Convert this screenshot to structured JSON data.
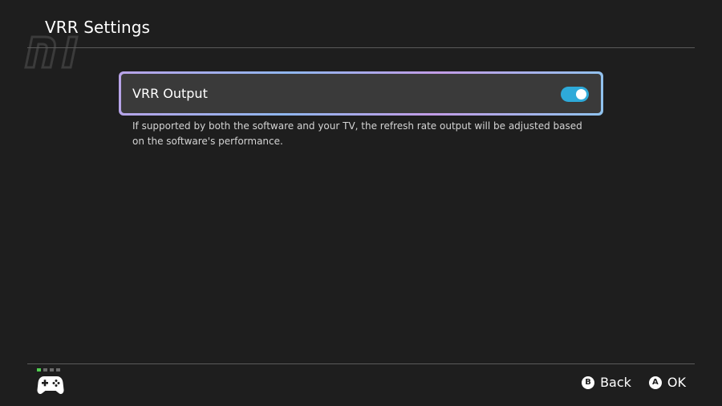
{
  "header": {
    "title": "VRR Settings"
  },
  "settings": {
    "vrr_output": {
      "label": "VRR Output",
      "enabled": true,
      "description": "If supported by both the software and your TV, the refresh rate output will be adjusted based on the software's performance."
    }
  },
  "footer": {
    "controller": {
      "icon": "gamepad-icon",
      "player_dots": 4,
      "active_player": 1
    },
    "actions": [
      {
        "glyph": "B",
        "label": "Back"
      },
      {
        "glyph": "A",
        "label": "OK"
      }
    ]
  },
  "colors": {
    "background": "#1e1e1e",
    "card": "#3a3a3a",
    "toggle_on": "#2eaad9",
    "player_active": "#50d050"
  }
}
